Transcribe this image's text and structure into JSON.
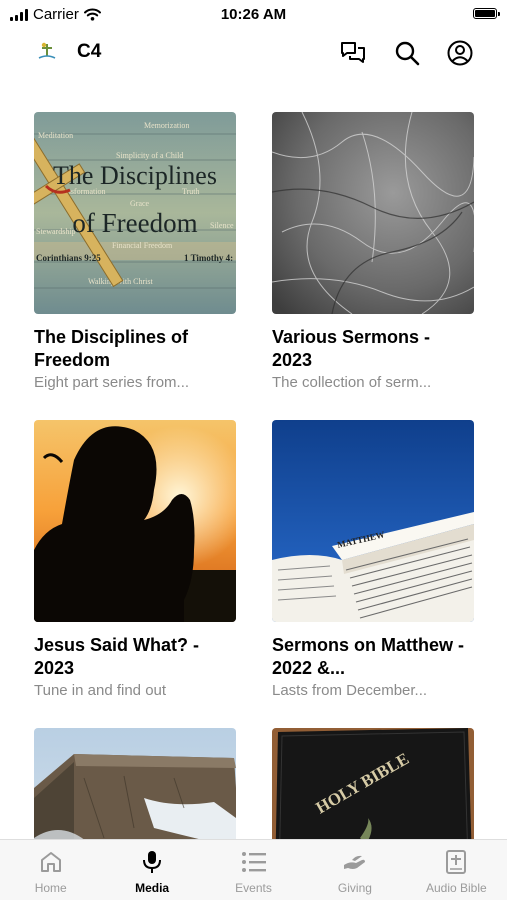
{
  "status_bar": {
    "carrier": "Carrier",
    "time": "10:26 AM"
  },
  "header": {
    "title": "C4"
  },
  "cards": [
    {
      "title": "The Disciplines of Freedom",
      "subtitle": "Eight part series from...",
      "art": {
        "big_line1": "The Disciplines",
        "big_line2": "of Freedom",
        "words": [
          "Memorization",
          "Meditation",
          "Simplicity of a Child",
          "Transformation",
          "Truth",
          "Grace",
          "Stewardship",
          "Financial Freedom",
          "Silence",
          "Walking with Christ"
        ],
        "ref_left": "Corinthians 9:25",
        "ref_right": "1 Timothy 4:"
      }
    },
    {
      "title": "Various Sermons - 2023",
      "subtitle": "The collection of serm..."
    },
    {
      "title": "Jesus Said What? - 2023",
      "subtitle": "Tune in and find out"
    },
    {
      "title": "Sermons on Matthew - 2022 &...",
      "subtitle": "Lasts from December...",
      "art": {
        "page_header": "MATTHEW"
      }
    },
    {
      "title": "",
      "subtitle": ""
    },
    {
      "title": "",
      "subtitle": "",
      "art": {
        "cover_text": "HOLY BIBLE"
      }
    }
  ],
  "tabs": [
    {
      "label": "Home",
      "icon": "home-icon",
      "active": false
    },
    {
      "label": "Media",
      "icon": "microphone-icon",
      "active": true
    },
    {
      "label": "Events",
      "icon": "list-icon",
      "active": false
    },
    {
      "label": "Giving",
      "icon": "giving-hand-icon",
      "active": false
    },
    {
      "label": "Audio Bible",
      "icon": "book-plus-icon",
      "active": false
    }
  ],
  "colors": {
    "active_tab": "#000000",
    "inactive_tab": "#9b9b9b",
    "subtitle": "#8a8a8a",
    "tabbar_bg": "#f7f7f7"
  }
}
